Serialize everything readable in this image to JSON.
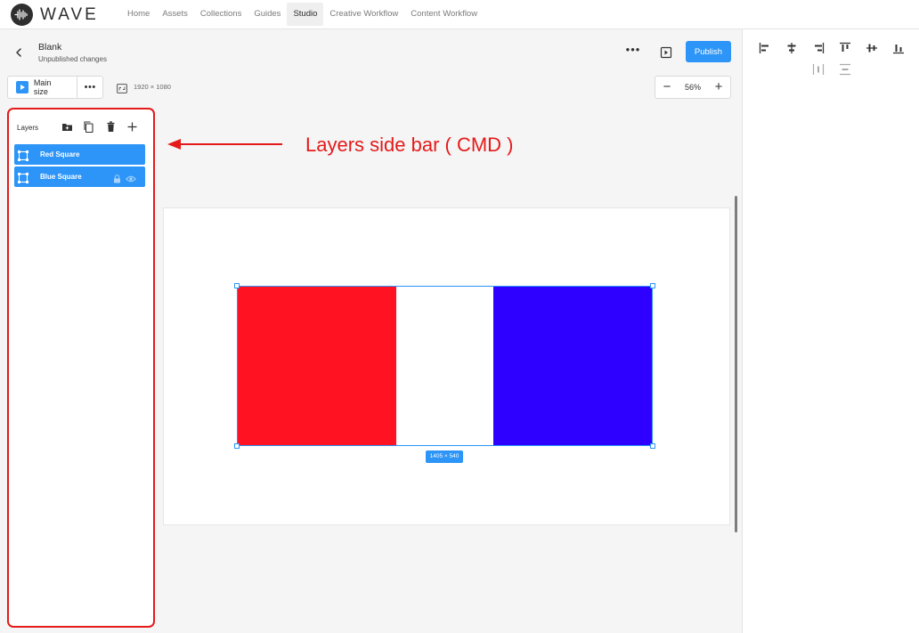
{
  "app": {
    "logo_text": "WAVE"
  },
  "nav": {
    "items": [
      "Home",
      "Assets",
      "Collections",
      "Guides",
      "Studio",
      "Creative Workflow",
      "Content Workflow"
    ],
    "active": "Studio"
  },
  "header": {
    "title": "Blank",
    "subtitle": "Unpublished changes",
    "more_label": "•••",
    "publish_label": "Publish"
  },
  "toolbar": {
    "size_label": "Main size",
    "size_more_label": "•••",
    "resolution": "1920 × 1080",
    "zoom_out_label": "−",
    "zoom_in_label": "+",
    "zoom": "56%"
  },
  "layers": {
    "heading": "Layers",
    "items": [
      {
        "name": "Red Square"
      },
      {
        "name": "Blue Square"
      }
    ]
  },
  "annotation": {
    "text": "Layers side bar ( CMD )"
  },
  "canvas": {
    "selection_size": "1405 × 540",
    "colors": {
      "red": "#ff1221",
      "blue": "#2d00ff",
      "accent": "#2d95f7"
    }
  }
}
